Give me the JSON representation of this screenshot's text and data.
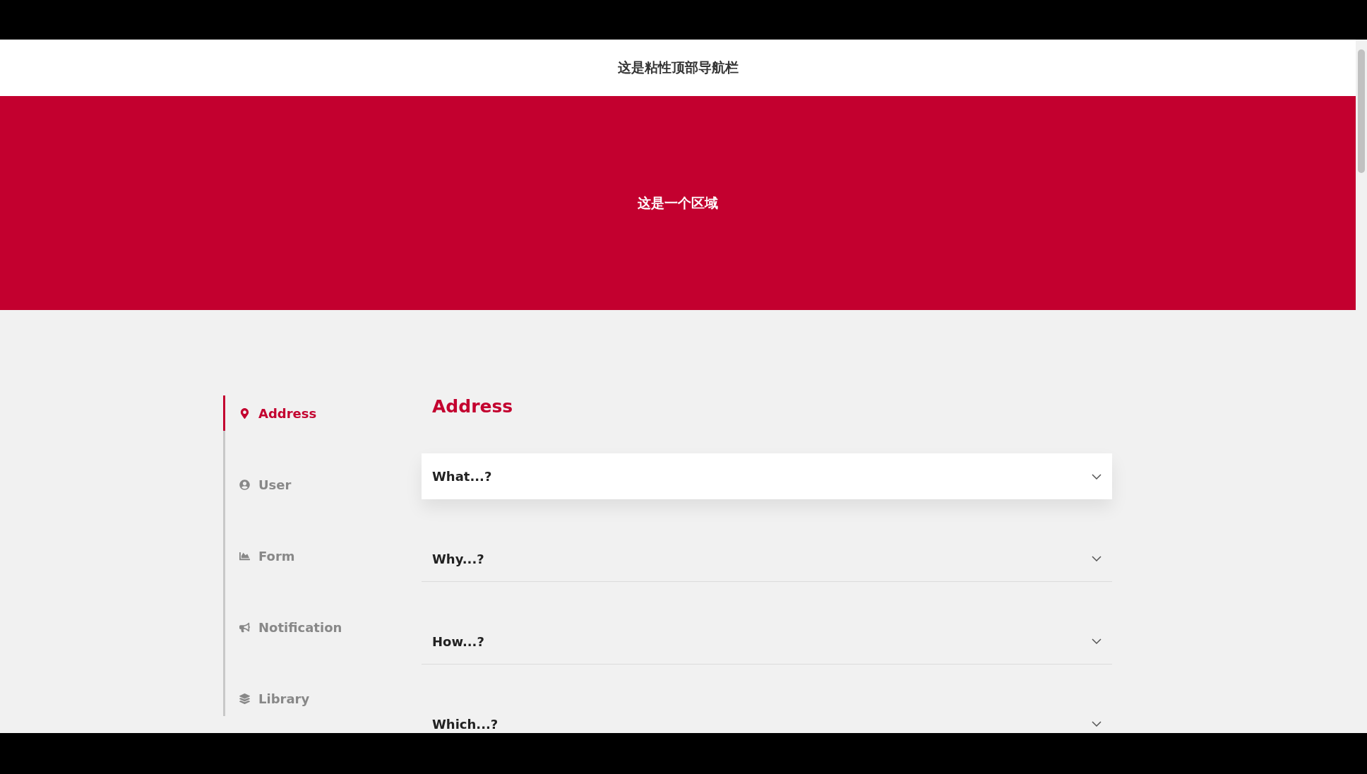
{
  "navbar": {
    "title": "这是粘性顶部导航栏"
  },
  "hero": {
    "text": "这是一个区域"
  },
  "sidebar": {
    "items": [
      {
        "label": "Address",
        "selected": true
      },
      {
        "label": "User",
        "selected": false
      },
      {
        "label": "Form",
        "selected": false
      },
      {
        "label": "Notification",
        "selected": false
      },
      {
        "label": "Library",
        "selected": false
      }
    ]
  },
  "section": {
    "title": "Address"
  },
  "accordion": {
    "items": [
      {
        "label": "What...?",
        "hovered": true
      },
      {
        "label": "Why...?",
        "hovered": false
      },
      {
        "label": "How...?",
        "hovered": false
      },
      {
        "label": "Which...?",
        "hovered": false
      }
    ]
  }
}
